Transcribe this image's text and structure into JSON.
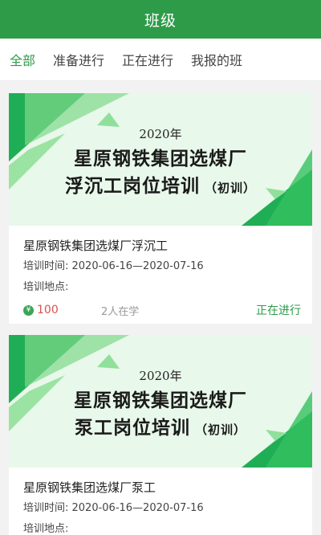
{
  "header": {
    "title": "班级"
  },
  "tabs": [
    {
      "label": "全部",
      "active": true
    },
    {
      "label": "准备进行",
      "active": false
    },
    {
      "label": "正在进行",
      "active": false
    },
    {
      "label": "我报的班",
      "active": false
    }
  ],
  "colors": {
    "accent": "#2e9b49",
    "price": "#d9534f"
  },
  "classes": [
    {
      "banner": {
        "year": "2020年",
        "line1": "星原钢铁集团选煤厂",
        "line2": "浮沉工岗位培训",
        "tag": "（初训）"
      },
      "title": "星原钢铁集团选煤厂浮沉工",
      "time": "培训时间: 2020-06-16—2020-07-16",
      "location": "培训地点:",
      "coin_icon": "yen-coin-icon",
      "coin_symbol": "¥",
      "price": "100",
      "learners": "2人在学",
      "status": "正在进行"
    },
    {
      "banner": {
        "year": "2020年",
        "line1": "星原钢铁集团选煤厂",
        "line2": "泵工岗位培训",
        "tag": "（初训）"
      },
      "title": "星原钢铁集团选煤厂泵工",
      "time": "培训时间: 2020-06-16—2020-07-16",
      "location": "培训地点:"
    }
  ]
}
